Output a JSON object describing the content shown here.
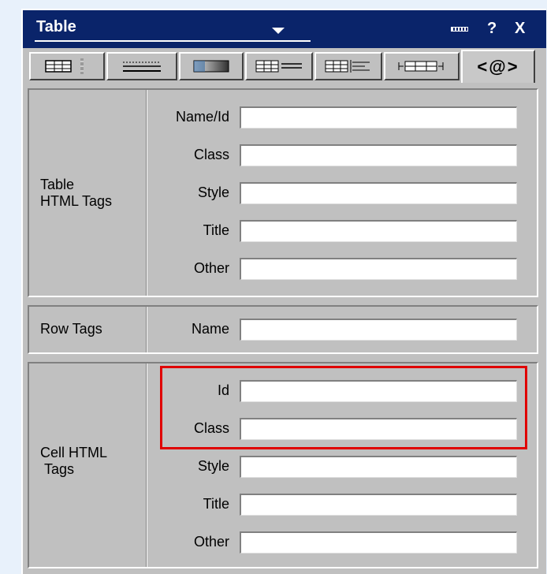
{
  "window": {
    "title": "Table",
    "icons": [
      "dropdown-arrow-icon",
      "collapse-icon",
      "help-icon",
      "close-icon"
    ],
    "help_glyph": "?",
    "close_glyph": "X"
  },
  "tabs": [
    {
      "name": "table-format-tab",
      "icon": "table-grid-icon"
    },
    {
      "name": "borders-tab",
      "icon": "border-lines-icon"
    },
    {
      "name": "background-tab",
      "icon": "gradient-fill-icon"
    },
    {
      "name": "rows-tab",
      "icon": "row-format-icon"
    },
    {
      "name": "cell-align-tab",
      "icon": "cell-align-icon"
    },
    {
      "name": "spacing-tab",
      "icon": "cell-spacing-icon"
    },
    {
      "name": "html-tags-tab",
      "label": "<@>",
      "active": true
    }
  ],
  "sections": {
    "table": {
      "label_line1": "Table",
      "label_line2": "HTML Tags",
      "fields": [
        {
          "label": "Name/Id",
          "value": ""
        },
        {
          "label": "Class",
          "value": ""
        },
        {
          "label": "Style",
          "value": ""
        },
        {
          "label": "Title",
          "value": ""
        },
        {
          "label": "Other",
          "value": ""
        }
      ]
    },
    "row": {
      "label": "Row Tags",
      "fields": [
        {
          "label": "Name",
          "value": ""
        }
      ]
    },
    "cell": {
      "label_line1": "Cell HTML",
      "label_line2": "Tags",
      "fields": [
        {
          "label": "Id",
          "value": ""
        },
        {
          "label": "Class",
          "value": ""
        },
        {
          "label": "Style",
          "value": ""
        },
        {
          "label": "Title",
          "value": ""
        },
        {
          "label": "Other",
          "value": ""
        }
      ]
    }
  },
  "colors": {
    "titlebar": "#0a246a",
    "panel": "#c0c0c0",
    "highlight": "#e00000",
    "background": "#e8f1fb"
  }
}
